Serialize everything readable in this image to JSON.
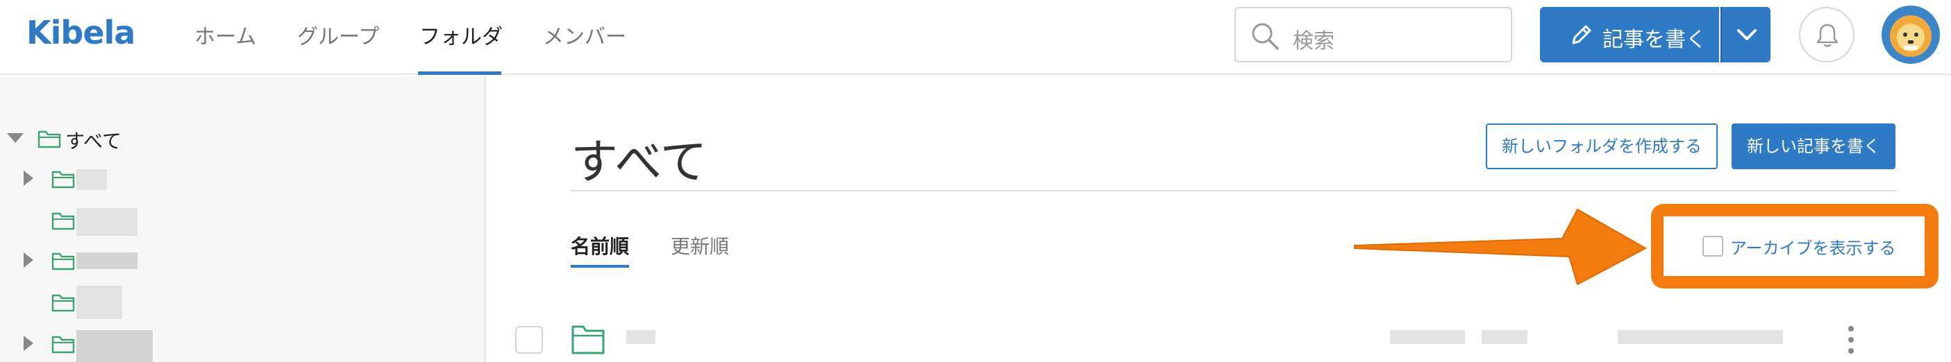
{
  "header": {
    "logo": "Kibela",
    "nav": [
      {
        "label": "ホーム",
        "active": false
      },
      {
        "label": "グループ",
        "active": false
      },
      {
        "label": "フォルダ",
        "active": true
      },
      {
        "label": "メンバー",
        "active": false
      }
    ],
    "search_placeholder": "検索",
    "write_label": "記事を書く"
  },
  "sidebar": {
    "root_label": "すべて"
  },
  "main": {
    "title": "すべて",
    "new_folder_label": "新しいフォルダを作成する",
    "new_article_label": "新しい記事を書く",
    "sort_tabs": [
      {
        "label": "名前順",
        "active": true
      },
      {
        "label": "更新順",
        "active": false
      }
    ],
    "archive_label": "アーカイブを表示する"
  },
  "colors": {
    "brand": "#2f7ac6",
    "highlight": "#f47c0f",
    "folder_icon": "#3aa374"
  }
}
